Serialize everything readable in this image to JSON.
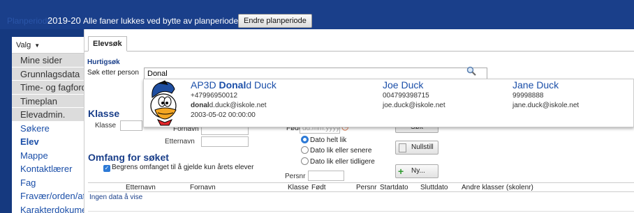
{
  "topbar": {
    "plan_label": "Planperiode",
    "year": "2019-20",
    "note": "Alle faner lukkes ved bytte av planperiode",
    "change_button": "Endre planperiode"
  },
  "sidebar": {
    "valg_label": "Valg",
    "items": [
      {
        "label": "Mine sider"
      },
      {
        "label": "Grunnlagsdata"
      },
      {
        "label": "Time- og fagfordeling"
      },
      {
        "label": "Timeplan"
      },
      {
        "label": "Elevadmin."
      },
      {
        "label": "Søkere"
      },
      {
        "label": "Elev"
      },
      {
        "label": "Mappe"
      },
      {
        "label": "Kontaktlærer"
      },
      {
        "label": "Fag"
      },
      {
        "label": "Fravær/orden/atferd"
      },
      {
        "label": "Karakterdokumentasjon"
      }
    ]
  },
  "tabs": [
    {
      "label": "Elevsøk"
    }
  ],
  "hurtigsok": {
    "title": "Hurtigsøk",
    "label": "Søk etter person",
    "value": "Donal"
  },
  "results": [
    {
      "name_prefix": "AP3D ",
      "name_match": "Donal",
      "name_suffix": "d Duck",
      "phone": "+47996950012",
      "email_match": "donal",
      "email_suffix": "d.duck@iskole.net",
      "date": "2003-05-02 00:00:00"
    },
    {
      "name": "Joe Duck",
      "phone": "004799398715",
      "email": "joe.duck@iskole.net"
    },
    {
      "name": "Jane Duck",
      "phone": "99998888",
      "email": "jane.duck@iskole.net"
    }
  ],
  "form": {
    "title": "Klasse",
    "klasse_label": "Klasse",
    "fornavn_label": "Fornavn",
    "etternavn_label": "Etternavn",
    "fodt_label": "Født",
    "fodt_placeholder": "dd.mm.yyyy",
    "radio_exact": "Dato helt lik",
    "radio_later": "Dato lik eller senere",
    "radio_earlier": "Dato lik eller tidligere",
    "persnr_label": "Persnr",
    "search_button": "Søk",
    "reset_button": "Nullstill",
    "new_button": "Ny..."
  },
  "scope": {
    "title": "Omfang for søket",
    "checkbox_label": "Begrens omfanget til å gjelde kun årets elever"
  },
  "table": {
    "columns": [
      "Etternavn",
      "Fornavn",
      "Klasse",
      "Født",
      "Persnr",
      "Startdato",
      "Sluttdato",
      "Andre klasser (skolenr)"
    ],
    "empty_text": "Ingen data å vise"
  }
}
